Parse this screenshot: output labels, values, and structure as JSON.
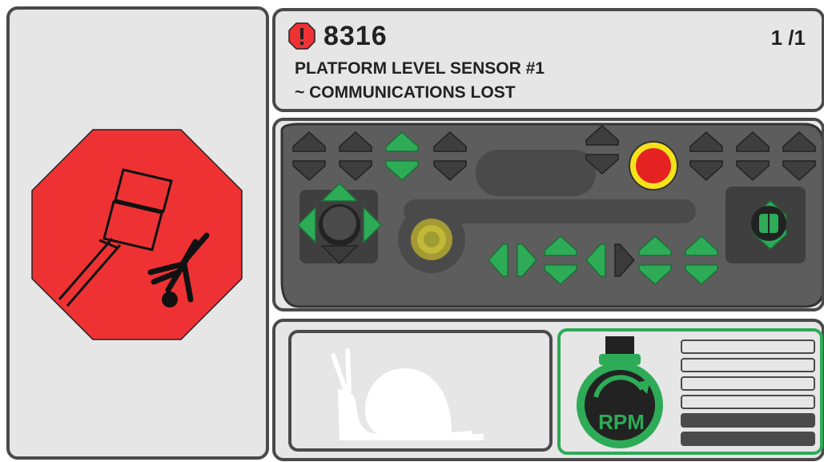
{
  "fault": {
    "code": "8316",
    "page": "1 /1",
    "line1": "PLATFORM LEVEL SENSOR #1",
    "line2": "~ COMMUNICATIONS LOST"
  },
  "icons": {
    "alert": "alert-octagon-icon",
    "crush_hazard": "tip-over-crush-hazard-icon",
    "drive_speed": "snail-icon",
    "rpm": "engine-rpm-icon",
    "estop": "emergency-stop-button-icon",
    "joystick": "joystick-icon",
    "key_switch": "key-switch-icon"
  },
  "rpm_gauge": {
    "label": "RPM",
    "levels_total": 6,
    "levels_filled": 2
  },
  "colors": {
    "stop_red": "#ee3234",
    "active_green": "#2eab57",
    "inactive_dark": "#454545",
    "panel_bg": "#e6e6e6",
    "estop_ring": "#f4e21b"
  }
}
